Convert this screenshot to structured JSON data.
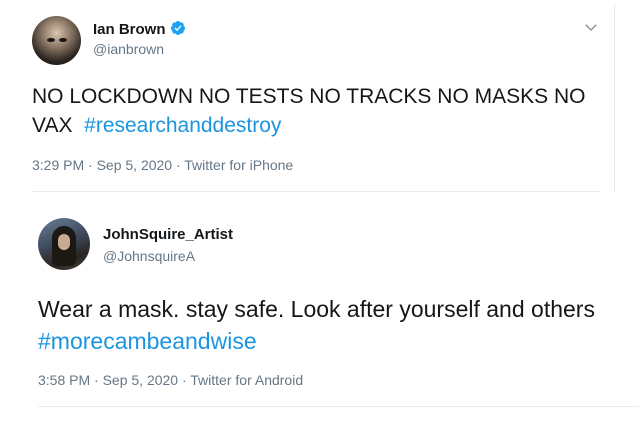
{
  "tweets": [
    {
      "name": "Ian Brown",
      "verified": true,
      "handle": "@ianbrown",
      "text": "NO LOCKDOWN NO TESTS NO TRACKS NO MASKS NO VAX",
      "hashtag": "#researchanddestroy",
      "timestamp": "3:29 PM · Sep 5, 2020 · Twitter for iPhone"
    },
    {
      "name": "JohnSquire_Artist",
      "verified": false,
      "handle": "@JohnsquireA",
      "text": "Wear a mask. stay safe. Look after yourself and others",
      "hashtag": "#morecambeandwise",
      "timestamp": "3:58 PM · Sep 5, 2020 · Twitter for Android"
    }
  ],
  "icons": {
    "verified": "verified-badge-icon",
    "caret": "chevron-down-icon"
  },
  "colors": {
    "hashtag": "#1b95e0",
    "secondary_text": "#657786",
    "primary_text": "#14171a",
    "verified": "#1da1f2"
  }
}
